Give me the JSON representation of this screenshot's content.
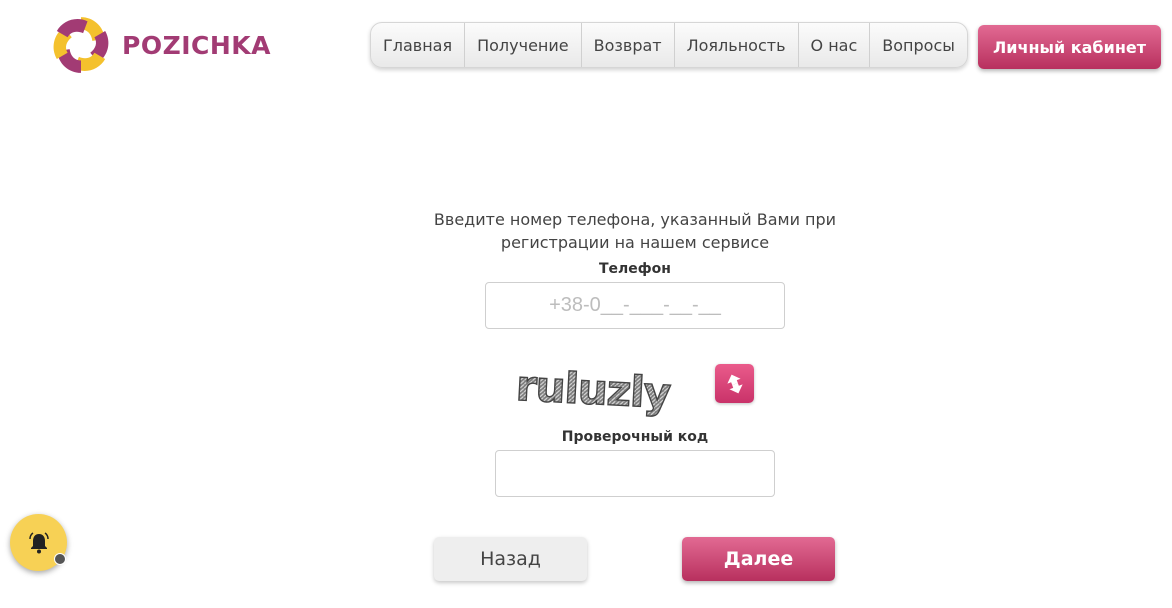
{
  "brand": {
    "name": "POZICHKA",
    "color": "#a23b74",
    "accent": "#f4c12d"
  },
  "nav": {
    "items": [
      {
        "label": "Главная"
      },
      {
        "label": "Получение"
      },
      {
        "label": "Возврат"
      },
      {
        "label": "Лояльность"
      },
      {
        "label": "О нас"
      },
      {
        "label": "Вопросы"
      }
    ]
  },
  "header": {
    "cabinet_label": "Личный кабинет",
    "cabinet_color": "#c93d6b"
  },
  "form": {
    "intro": "Введите номер телефона, указанный Вами при регистрации на нашем сервисе",
    "phone_label": "Телефон",
    "phone_placeholder": "+38-0__-___-__-__",
    "captcha_text": "ruluzly",
    "refresh_icon": "refresh-icon",
    "code_label": "Проверочный код",
    "code_value": "",
    "back_label": "Назад",
    "next_label": "Далее"
  },
  "widget": {
    "icon": "bell-icon",
    "color": "#f7d155"
  }
}
